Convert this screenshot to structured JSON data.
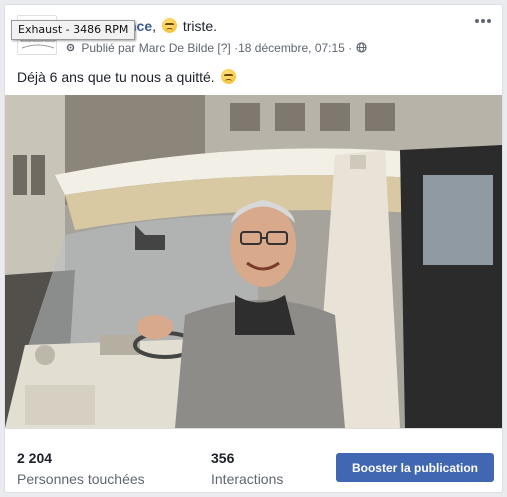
{
  "tooltip": {
    "text": "Exhaust - 3486 RPM"
  },
  "post": {
    "page_name_partial": "ub de France",
    "feeling": "triste.",
    "published_by": "Publié par Marc De Bilde",
    "help_marker": "[?]",
    "separator": "·",
    "date": "18 décembre, 07:15",
    "message": "Déjà 6 ans que tu nous a quitté."
  },
  "icons": {
    "emoji_sad": "sad-face-emoji",
    "globe": "globe-icon",
    "more": "more-options-icon"
  },
  "stats": {
    "reach_value": "2 204",
    "reach_label": "Personnes touchées",
    "interactions_value": "356",
    "interactions_label": "Interactions"
  },
  "actions": {
    "boost_label": "Booster la publication"
  },
  "colors": {
    "brand": "#4267b2",
    "link": "#385898",
    "text": "#1d2129",
    "muted": "#606770"
  }
}
